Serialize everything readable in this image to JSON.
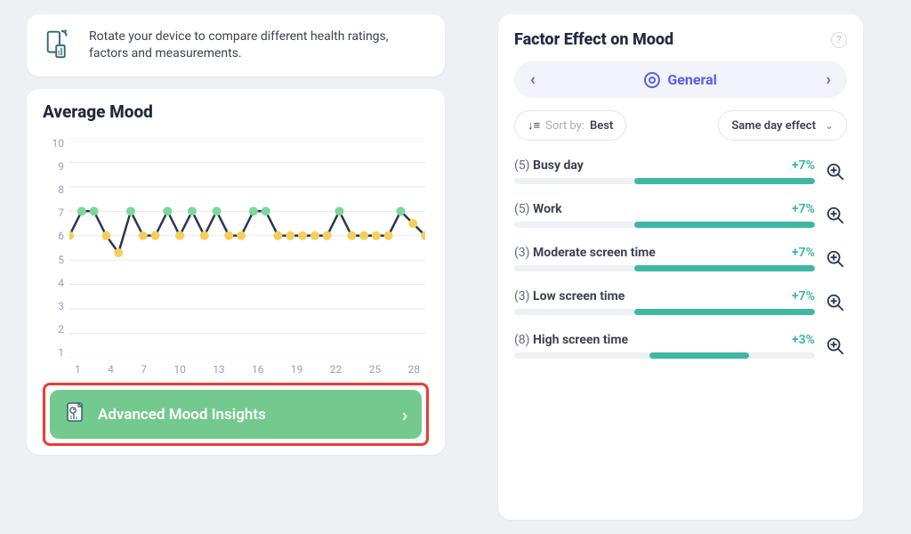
{
  "rotate_banner": {
    "text": "Rotate your device to compare different health ratings, factors and measurements."
  },
  "chart": {
    "title": "Average Mood"
  },
  "chart_data": {
    "type": "line",
    "title": "Average Mood",
    "xlabel": "",
    "ylabel": "",
    "ylim": [
      1,
      10
    ],
    "x_tick_labels": [
      "1",
      "4",
      "7",
      "10",
      "13",
      "16",
      "19",
      "22",
      "25",
      "28"
    ],
    "x": [
      1,
      2,
      3,
      4,
      5,
      6,
      7,
      8,
      9,
      10,
      11,
      12,
      13,
      14,
      15,
      16,
      17,
      18,
      19,
      20,
      21,
      22,
      23,
      24,
      25,
      26,
      27,
      28,
      29,
      30
    ],
    "values": [
      6,
      7,
      7,
      6,
      5.3,
      7,
      6,
      6,
      7,
      6,
      7,
      6,
      7,
      6,
      6,
      7,
      7,
      6,
      6,
      6,
      6,
      6,
      7,
      6,
      6,
      6,
      6,
      7,
      6.5,
      6
    ],
    "point_color_map": {
      "6": "yellow",
      "7": "green",
      "5.3": "yellow",
      "6.5": "yellow"
    }
  },
  "insights_button": {
    "label": "Advanced Mood Insights"
  },
  "factor_panel": {
    "title": "Factor Effect on Mood",
    "category": "General",
    "sort_prefix": "Sort by:",
    "sort_value": "Best",
    "effect_dropdown": "Same day effect",
    "factors": [
      {
        "count": 5,
        "name": "Busy day",
        "pct": "+7%",
        "fill_start": 40,
        "fill_end": 100
      },
      {
        "count": 5,
        "name": "Work",
        "pct": "+7%",
        "fill_start": 40,
        "fill_end": 100
      },
      {
        "count": 3,
        "name": "Moderate screen time",
        "pct": "+7%",
        "fill_start": 40,
        "fill_end": 100
      },
      {
        "count": 3,
        "name": "Low screen time",
        "pct": "+7%",
        "fill_start": 40,
        "fill_end": 100
      },
      {
        "count": 8,
        "name": "High screen time",
        "pct": "+3%",
        "fill_start": 45,
        "fill_end": 78
      }
    ]
  }
}
